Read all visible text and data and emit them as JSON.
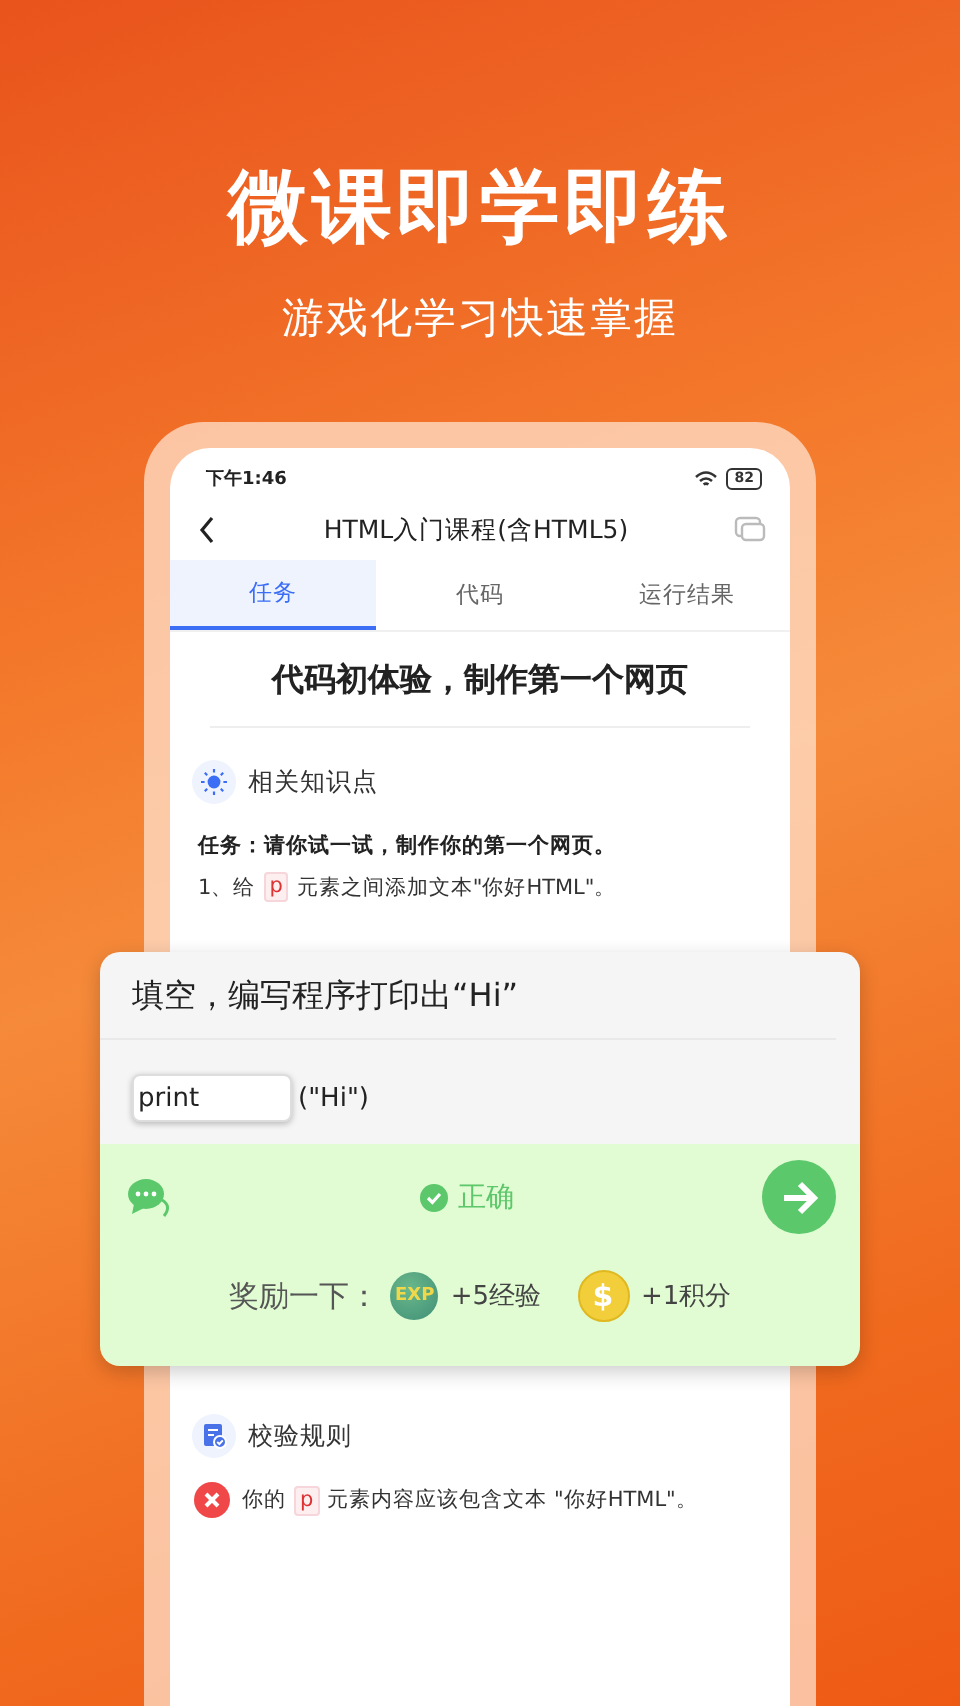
{
  "hero": {
    "title": "微课即学即练",
    "subtitle": "游戏化学习快速掌握"
  },
  "status_bar": {
    "time": "下午1:46",
    "battery": "82"
  },
  "nav": {
    "title": "HTML入门课程(含HTML5)"
  },
  "tabs": [
    {
      "label": "任务",
      "selected": true
    },
    {
      "label": "代码",
      "selected": false
    },
    {
      "label": "运行结果",
      "selected": false
    }
  ],
  "lesson": {
    "heading": "代码初体验，制作第一个网页",
    "knowledge_title": "相关知识点",
    "task": "任务：请你试一试，制作你的第一个网页。",
    "step": {
      "before": "1、给",
      "code": "p",
      "after": "元素之间添加文本\"你好HTML\"。"
    }
  },
  "quiz": {
    "question": "填空，编写程序打印出“Hi”",
    "answer": "print",
    "suffix": "(\"Hi\")",
    "result": "正确",
    "correct": true,
    "reward_label": "奖励一下：",
    "rewards": [
      {
        "kind": "exp",
        "badge": "EXP",
        "text": "+5经验"
      },
      {
        "kind": "coin",
        "badge": "$",
        "text": "+1积分"
      }
    ]
  },
  "rules": {
    "title": "校验规则",
    "items": [
      {
        "passed": false,
        "before": "你的",
        "code": "p",
        "after": "元素内容应该包含文本 \"你好HTML\"。"
      }
    ]
  }
}
